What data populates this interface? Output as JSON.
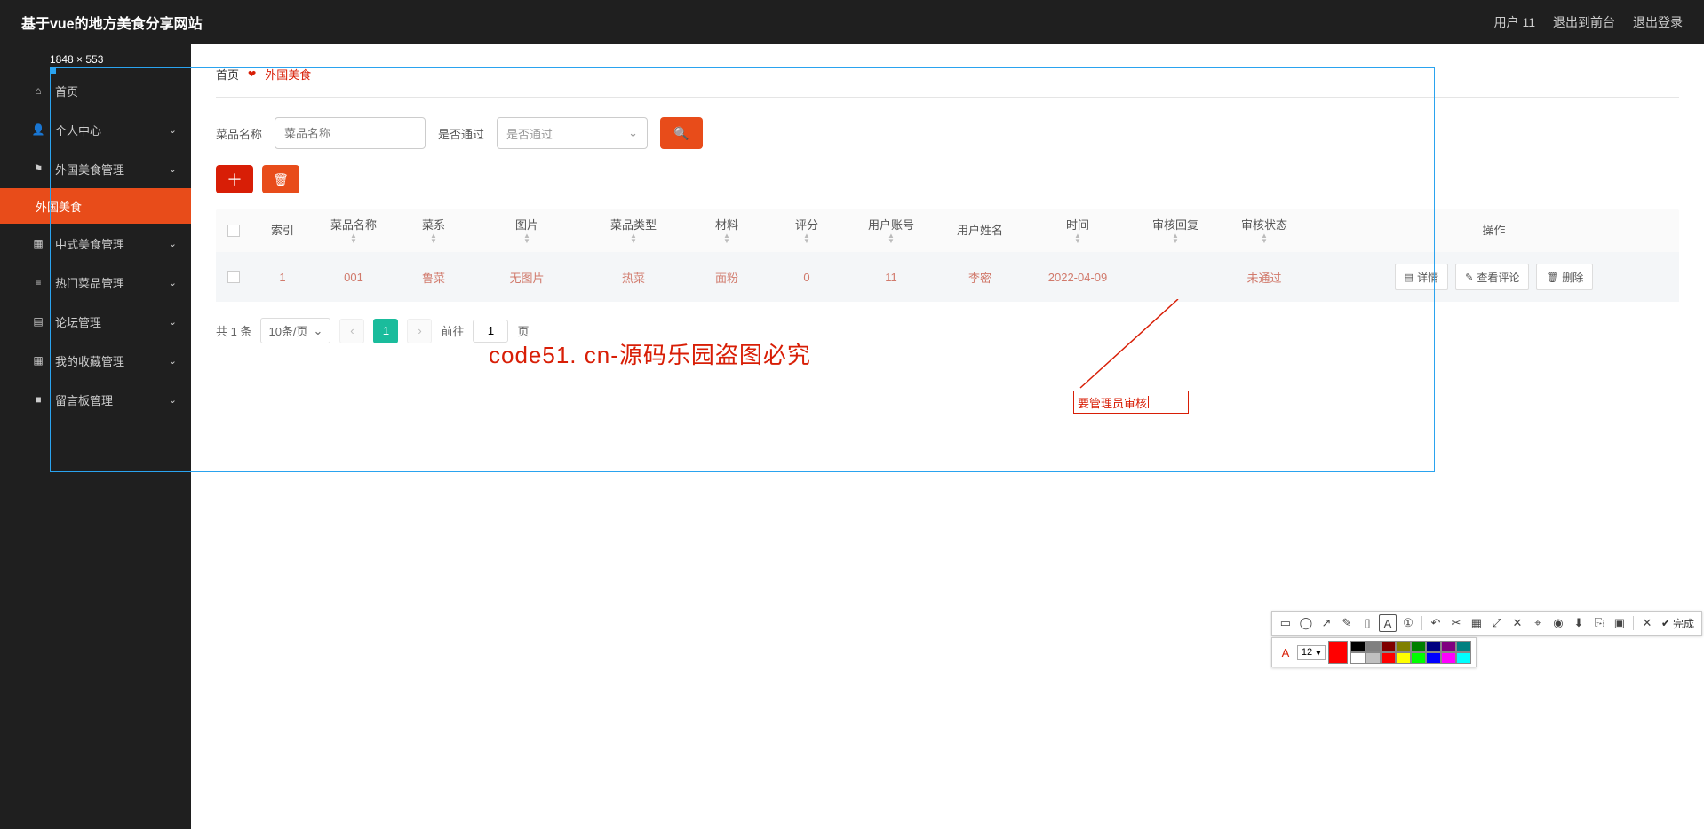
{
  "watermark": "code51.cn",
  "header": {
    "title": "基于vue的地方美食分享网站",
    "user_label": "用户 11",
    "to_front": "退出到前台",
    "logout": "退出登录"
  },
  "size_label": "1848 × 553",
  "sidebar": {
    "home": "首页",
    "items": [
      {
        "label": "个人中心"
      },
      {
        "label": "外国美食管理",
        "sub": "外国美食",
        "active": true
      },
      {
        "label": "中式美食管理"
      },
      {
        "label": "热门菜品管理"
      },
      {
        "label": "论坛管理"
      },
      {
        "label": "我的收藏管理"
      },
      {
        "label": "留言板管理"
      }
    ]
  },
  "breadcrumb": {
    "home": "首页",
    "current": "外国美食"
  },
  "filters": {
    "name_label": "菜品名称",
    "name_placeholder": "菜品名称",
    "pass_label": "是否通过",
    "pass_placeholder": "是否通过"
  },
  "table": {
    "headers": [
      "索引",
      "菜品名称",
      "菜系",
      "图片",
      "菜品类型",
      "材料",
      "评分",
      "用户账号",
      "用户姓名",
      "时间",
      "审核回复",
      "审核状态",
      "操作"
    ],
    "row": {
      "index": "1",
      "name": "001",
      "cuisine": "鲁菜",
      "image": "无图片",
      "type": "热菜",
      "material": "面粉",
      "score": "0",
      "account": "11",
      "username": "李密",
      "time": "2022-04-09",
      "reply": "",
      "status": "未通过",
      "ops": {
        "detail": "详情",
        "comments": "查看评论",
        "delete": "删除"
      }
    }
  },
  "pager": {
    "total": "共 1 条",
    "per_page": "10条/页",
    "page": "1",
    "goto": "前往",
    "unit": "页"
  },
  "annotation": {
    "big": "code51. cn-源码乐园盗图必究",
    "box": "要管理员审核"
  },
  "toolbar": {
    "done": "完成",
    "font_size": "12",
    "current_color": "#ff0000",
    "palette": [
      "#000000",
      "#808080",
      "#800000",
      "#808000",
      "#008000",
      "#000080",
      "#800080",
      "#008080",
      "#ffffff",
      "#c0c0c0",
      "#ff0000",
      "#ffff00",
      "#00ff00",
      "#0000ff",
      "#ff00ff",
      "#00ffff"
    ]
  }
}
